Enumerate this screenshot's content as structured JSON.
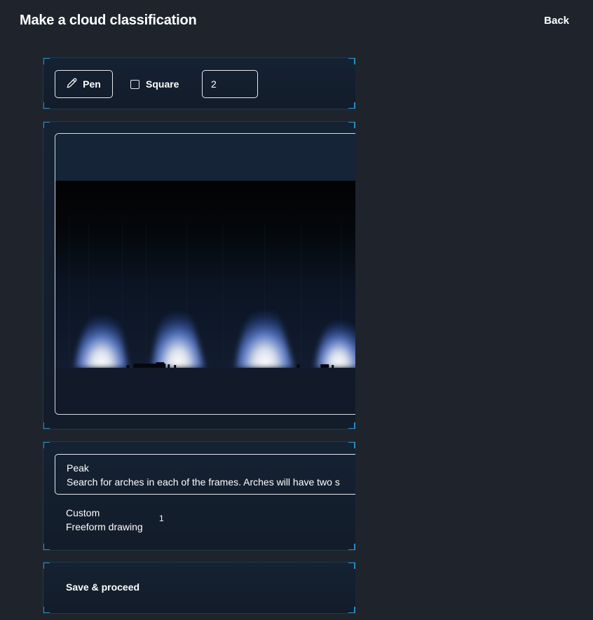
{
  "header": {
    "title": "Make a cloud classification",
    "back_label": "Back"
  },
  "toolbar": {
    "pen_label": "Pen",
    "square_label": "Square",
    "size_value": "2"
  },
  "tasks": [
    {
      "title": "Peak",
      "description": "Search for arches in each of the frames. Arches will have two s"
    },
    {
      "title": "Custom",
      "description": "Freeform drawing",
      "count": "1"
    }
  ],
  "footer": {
    "save_label": "Save & proceed"
  },
  "colors": {
    "background": "#1f242c",
    "panel": "#142233",
    "panel_corner": "#2a8bc4",
    "glow_blue": "#3f6fd8"
  }
}
